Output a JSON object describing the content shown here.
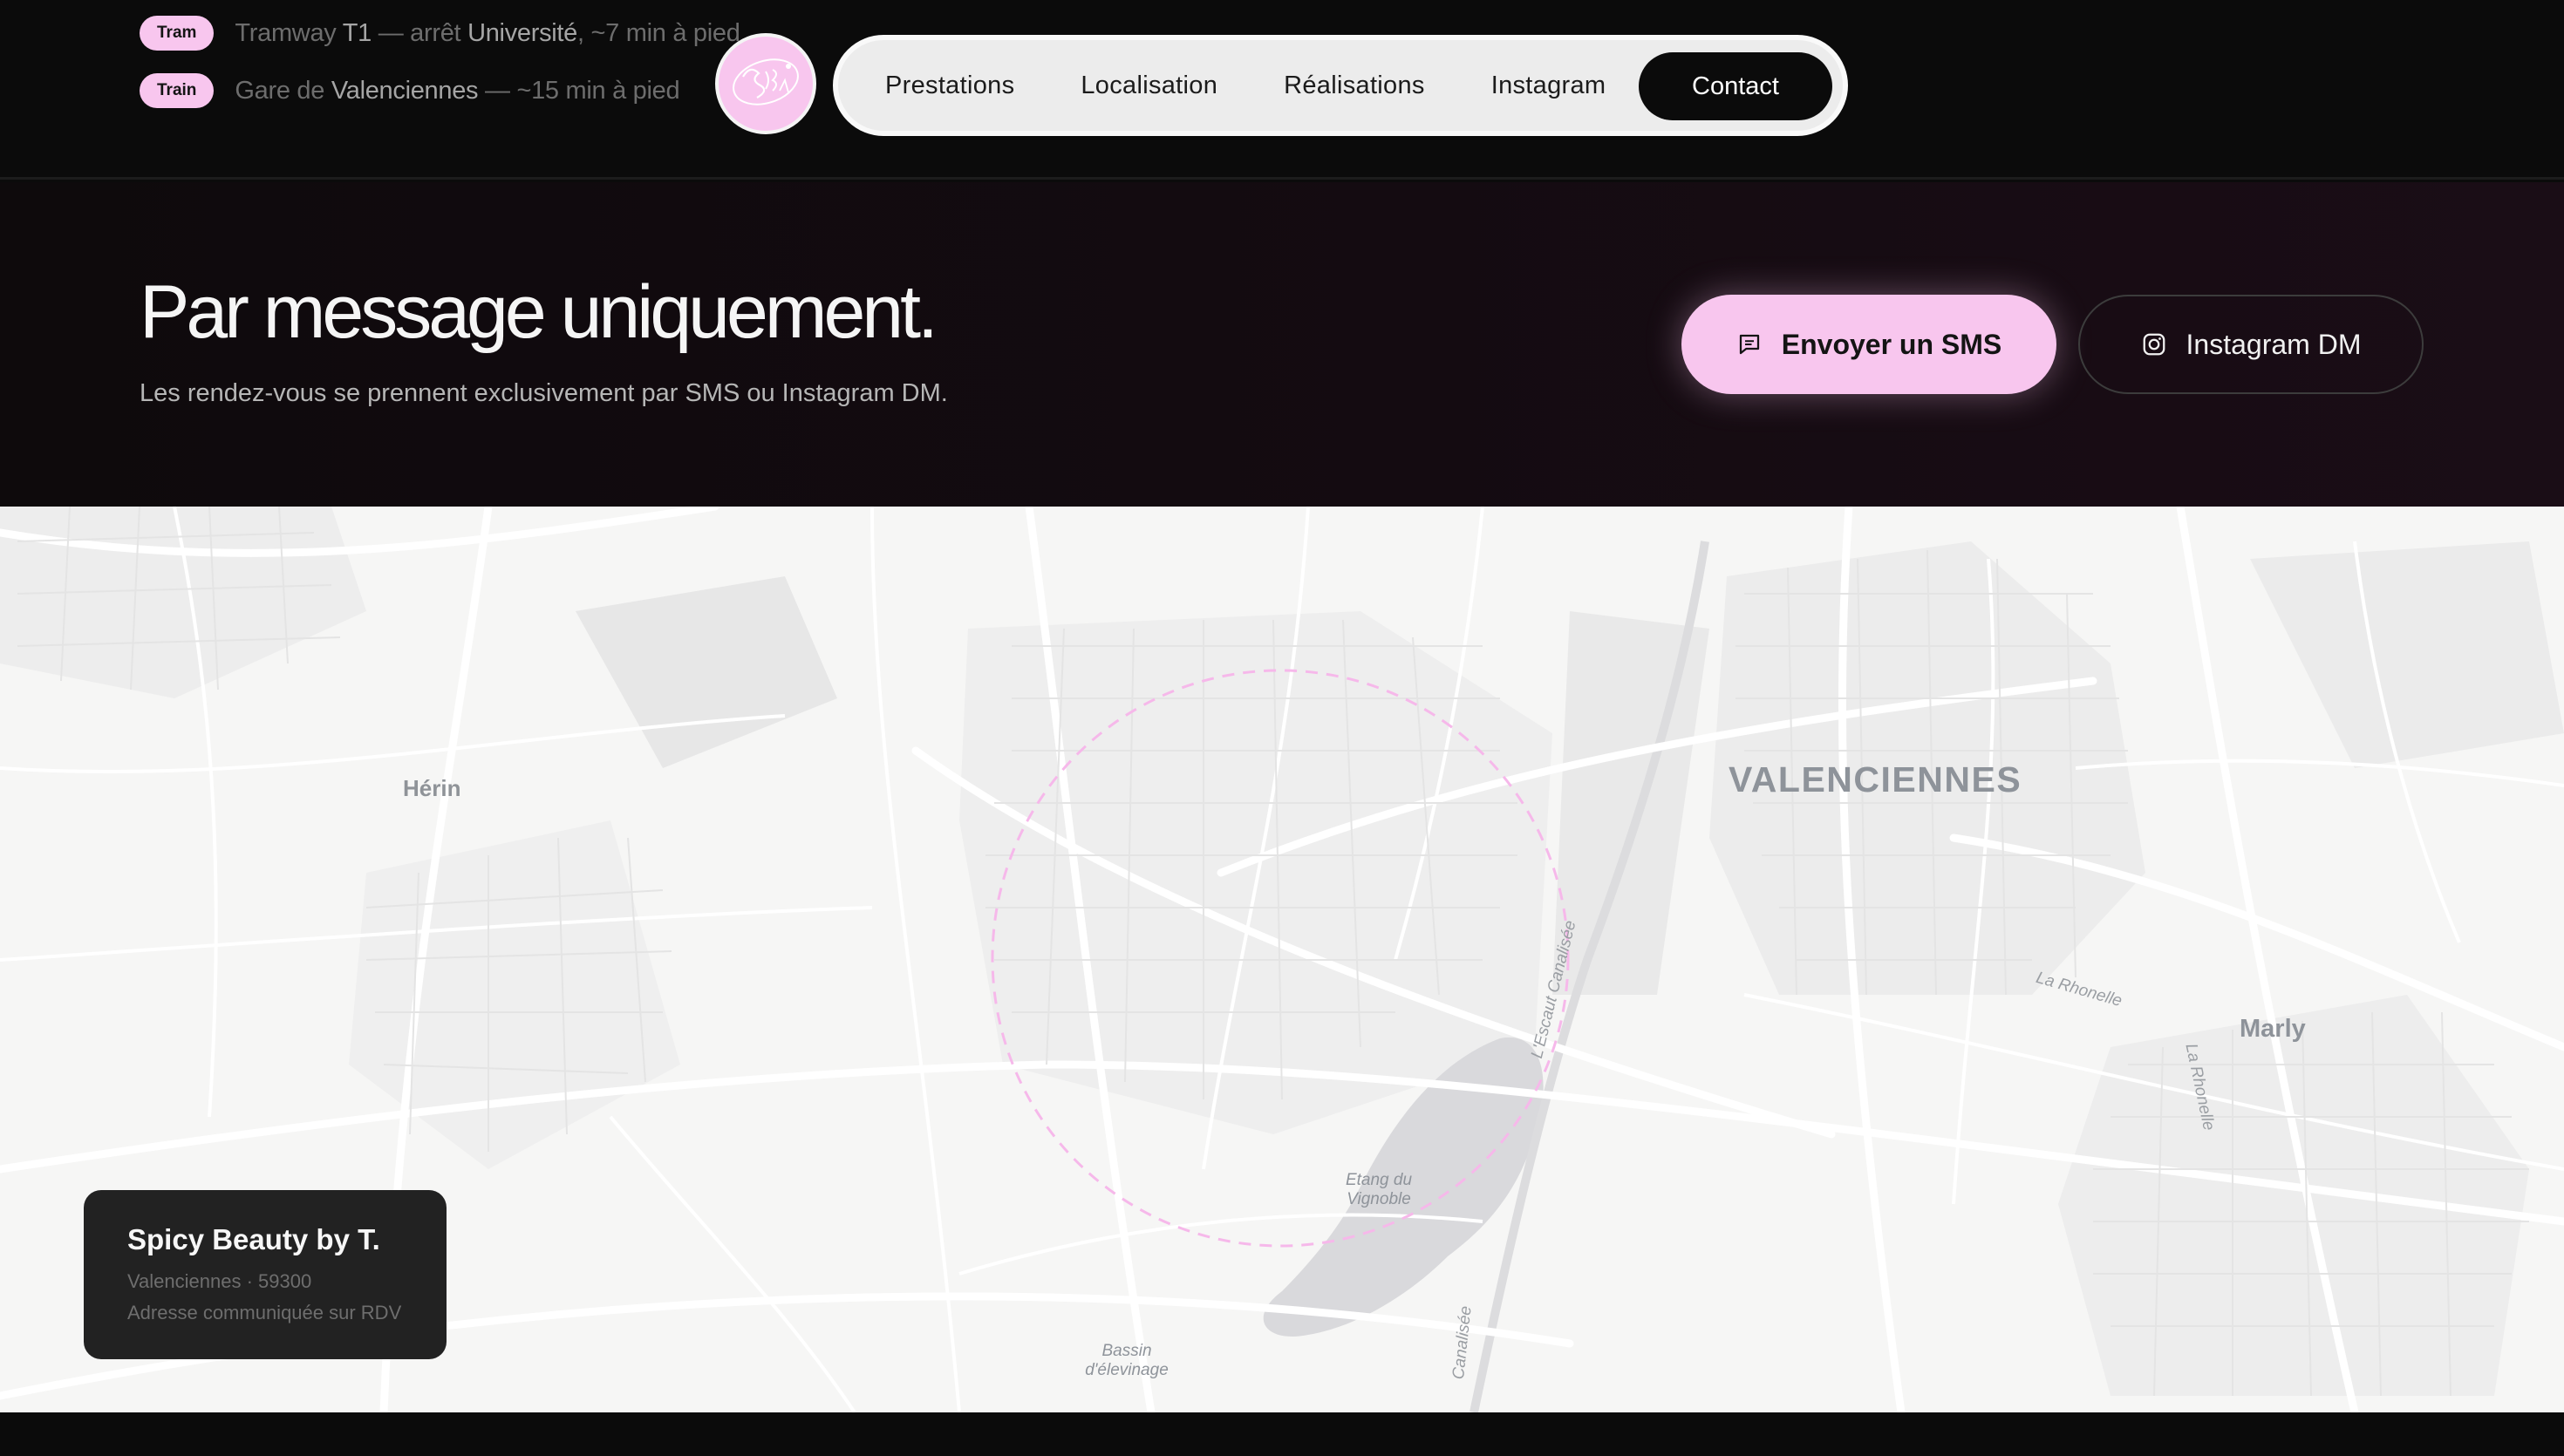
{
  "transport": [
    {
      "badge": "Tram",
      "prefix": "Tramway ",
      "line": "T1",
      "mid": " — arrêt ",
      "stop": "Université",
      "suffix": ", ~7 min à pied"
    },
    {
      "badge": "Train",
      "prefix": "Gare de ",
      "line": "Valenciennes",
      "mid": "",
      "stop": "",
      "suffix": " — ~15 min à pied"
    }
  ],
  "logo": {
    "alt": "Spicy Beauty"
  },
  "nav": {
    "items": [
      "Prestations",
      "Localisation",
      "Réalisations",
      "Instagram"
    ],
    "contact": "Contact"
  },
  "hero": {
    "title": "Par message uniquement.",
    "subtitle": "Les rendez-vous se prennent exclusivement par SMS ou Instagram DM.",
    "sms_button": "Envoyer un SMS",
    "instagram_button": "Instagram DM"
  },
  "map": {
    "labels": {
      "herin": "Hérin",
      "valenciennes": "VALENCIENNES",
      "marly": "Marly",
      "etang": "Etang du Vignoble",
      "bassin": "Bassin d'élevinage",
      "escaut": "L'Escaut Canalisée",
      "rhone": "La Rhonelle",
      "rhonelle": "La Rhonelle",
      "canalisee": "Canalisée"
    },
    "card": {
      "name": "Spicy Beauty by T.",
      "city": "Valenciennes · 59300",
      "note": "Adresse communiquée sur RDV"
    }
  },
  "colors": {
    "accent": "#f8c6ee",
    "background": "#0b0b0b",
    "map_bg": "#f6f6f5",
    "radius_ring": "#f6b8ea"
  }
}
